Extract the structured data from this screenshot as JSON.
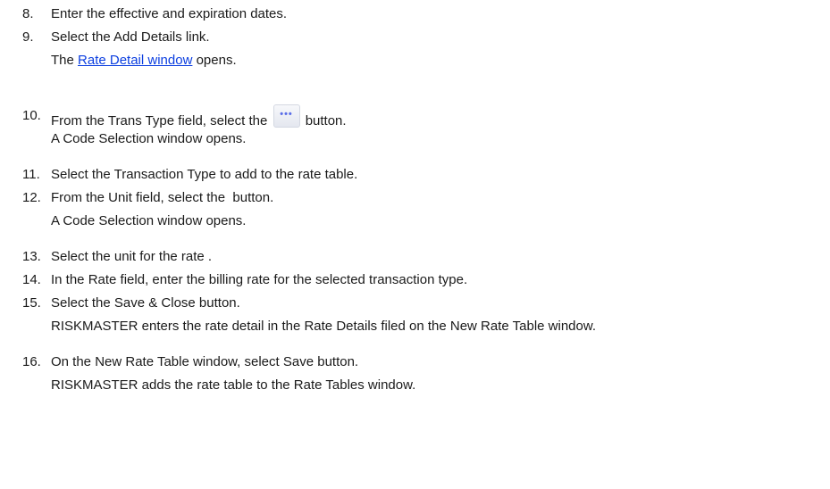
{
  "steps": [
    {
      "num": "8.",
      "text": "Enter the effective and expiration dates."
    },
    {
      "num": "9.",
      "text": "Select the Add Details link.",
      "result_prefix": "The ",
      "result_link": "Rate Detail window",
      "result_suffix": " opens."
    },
    {
      "num": "10.",
      "text_before": "From the Trans Type field, select the",
      "text_after": "button.",
      "button_icon": "ellipsis-icon",
      "result": "A Code Selection window opens."
    },
    {
      "num": "11.",
      "text": "Select the Transaction Type to add to the rate table."
    },
    {
      "num": "12.",
      "text": "From the Unit field, select the  button.",
      "result": "A Code Selection window opens."
    },
    {
      "num": "13.",
      "text": "Select the unit for the rate ."
    },
    {
      "num": "14.",
      "text": "In the Rate field, enter the billing rate for the selected transaction type."
    },
    {
      "num": "15.",
      "text": "Select the Save & Close button.",
      "result": "RISKMASTER enters the rate detail in the Rate Details filed on the New Rate Table window."
    },
    {
      "num": "16.",
      "text": "On the New Rate Table window, select Save button.",
      "result": "RISKMASTER adds the rate table to the Rate Tables window."
    }
  ],
  "colors": {
    "link": "#0b3ee0",
    "text": "#1a1a1a",
    "button_dots": "#5a6ee8"
  }
}
